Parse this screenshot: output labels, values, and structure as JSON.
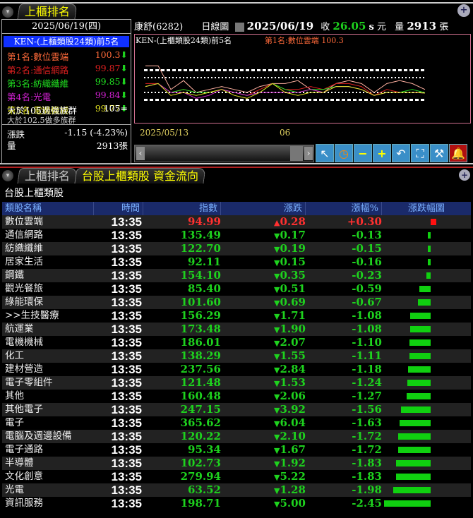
{
  "top_tab": "上櫃排名",
  "ranking_panel": {
    "date": "2025/06/19(四)",
    "title": "KEN-(上櫃類股24類)前5名",
    "items": [
      {
        "label": "第1名:數位雲端",
        "value": "100.3",
        "color": "#ff6a3a"
      },
      {
        "label": "第2名:通信網路",
        "value": "99.87",
        "color": "#e02020"
      },
      {
        "label": "第3名:紡織纖維",
        "value": "99.85",
        "color": "#20e020"
      },
      {
        "label": "第4名:光電",
        "value": "99.84",
        "color": "#d020d0"
      },
      {
        "label": "第5名:電機機械",
        "value": "99.77",
        "color": "#e0e020"
      }
    ],
    "strong_label": "大於105過強族群",
    "strong_value": "105=",
    "bull_label": "大於102.5做多族群",
    "change_label": "漲跌",
    "change_value": "-1.15 (-4.23%)",
    "volume_label": "量",
    "volume_value": "2913張"
  },
  "chart_header": {
    "stock": "康舒(6282)",
    "period": "日線圖",
    "date": "2025/06/19",
    "close_label": "收",
    "close": "26.05",
    "close_suffix": "s",
    "unit": "元",
    "vol_label": "量",
    "vol": "2913",
    "vol_unit": "張"
  },
  "chart_data": {
    "type": "line",
    "title": "KEN-(上櫃類股24類)前5名",
    "legend": "第1名:數位雲端 100.3",
    "x_ticks": [
      "2025/05/13",
      "06"
    ],
    "ylim": [
      90,
      115
    ],
    "reference_lines": [
      107.5,
      105,
      100,
      97.5
    ],
    "series": [
      {
        "name": "數位雲端",
        "color": "#ffb0a0",
        "values": [
          109,
          109,
          101,
          104,
          100,
          101,
          102,
          101,
          100,
          102,
          103,
          103,
          104,
          101,
          100,
          103,
          104,
          103,
          100,
          103,
          104,
          103,
          101
        ]
      },
      {
        "name": "通信網路",
        "color": "#e02020",
        "values": [
          103,
          103,
          100,
          101,
          100,
          100,
          101,
          100,
          99,
          101,
          103,
          101,
          101,
          102,
          101,
          103,
          103,
          102,
          99,
          101,
          100,
          100,
          99.9
        ]
      },
      {
        "name": "紡織纖維",
        "color": "#20e020",
        "values": [
          102,
          103,
          100,
          101,
          100,
          100,
          101,
          100,
          99,
          100,
          103,
          101,
          100,
          101,
          101,
          102,
          102,
          101,
          99,
          100,
          100,
          101,
          99.9
        ]
      },
      {
        "name": "光電",
        "color": "#d020d0",
        "values": [
          102,
          103,
          100,
          100,
          98,
          99,
          101,
          100,
          99,
          100,
          100,
          100,
          100,
          101,
          100,
          102,
          102,
          101,
          99,
          100,
          100,
          100,
          99.8
        ]
      },
      {
        "name": "電機機械",
        "color": "#e0e020",
        "values": [
          102,
          103,
          99,
          100,
          99,
          100,
          101,
          99,
          98,
          100,
          103,
          100,
          99,
          100,
          100,
          102,
          102,
          101,
          99,
          100,
          100,
          100,
          99.8
        ]
      }
    ]
  },
  "bottom_tabs": [
    "上櫃排名",
    "台股上櫃類股 資金流向"
  ],
  "table_title": "台股上櫃類股",
  "columns": [
    "類股名稱",
    "時間",
    "指數",
    "漲跌",
    "漲幅%",
    "漲跌幅圖"
  ],
  "rows": [
    {
      "name": "數位雲端",
      "time": "13:35",
      "index": "94.99",
      "chg": "0.28",
      "pct": "+0.30",
      "pv": 0.3
    },
    {
      "name": "通信網路",
      "time": "13:35",
      "index": "135.49",
      "chg": "0.17",
      "pct": "-0.13",
      "pv": -0.13
    },
    {
      "name": "紡織纖維",
      "time": "13:35",
      "index": "122.70",
      "chg": "0.19",
      "pct": "-0.15",
      "pv": -0.15
    },
    {
      "name": "居家生活",
      "time": "13:35",
      "index": "92.11",
      "chg": "0.15",
      "pct": "-0.16",
      "pv": -0.16
    },
    {
      "name": "鋼鐵",
      "time": "13:35",
      "index": "154.10",
      "chg": "0.35",
      "pct": "-0.23",
      "pv": -0.23
    },
    {
      "name": "觀光餐旅",
      "time": "13:35",
      "index": "85.40",
      "chg": "0.51",
      "pct": "-0.59",
      "pv": -0.59
    },
    {
      "name": "綠能環保",
      "time": "13:35",
      "index": "101.60",
      "chg": "0.69",
      "pct": "-0.67",
      "pv": -0.67
    },
    {
      "name": ">>生技醫療",
      "time": "13:35",
      "index": "156.29",
      "chg": "1.71",
      "pct": "-1.08",
      "pv": -1.08
    },
    {
      "name": "航運業",
      "time": "13:35",
      "index": "173.48",
      "chg": "1.90",
      "pct": "-1.08",
      "pv": -1.08
    },
    {
      "name": "電機機械",
      "time": "13:35",
      "index": "186.01",
      "chg": "2.07",
      "pct": "-1.10",
      "pv": -1.1
    },
    {
      "name": "化工",
      "time": "13:35",
      "index": "138.29",
      "chg": "1.55",
      "pct": "-1.11",
      "pv": -1.11
    },
    {
      "name": "建材營造",
      "time": "13:35",
      "index": "237.56",
      "chg": "2.84",
      "pct": "-1.18",
      "pv": -1.18
    },
    {
      "name": "電子零組件",
      "time": "13:35",
      "index": "121.48",
      "chg": "1.53",
      "pct": "-1.24",
      "pv": -1.24
    },
    {
      "name": "其他",
      "time": "13:35",
      "index": "160.48",
      "chg": "2.06",
      "pct": "-1.27",
      "pv": -1.27
    },
    {
      "name": "其他電子",
      "time": "13:35",
      "index": "247.15",
      "chg": "3.92",
      "pct": "-1.56",
      "pv": -1.56
    },
    {
      "name": "電子",
      "time": "13:35",
      "index": "365.62",
      "chg": "6.04",
      "pct": "-1.63",
      "pv": -1.63
    },
    {
      "name": "電腦及週邊設備",
      "time": "13:35",
      "index": "120.22",
      "chg": "2.10",
      "pct": "-1.72",
      "pv": -1.72
    },
    {
      "name": "電子通路",
      "time": "13:35",
      "index": "95.34",
      "chg": "1.67",
      "pct": "-1.72",
      "pv": -1.72
    },
    {
      "name": "半導體",
      "time": "13:35",
      "index": "102.73",
      "chg": "1.92",
      "pct": "-1.83",
      "pv": -1.83
    },
    {
      "name": "文化創意",
      "time": "13:35",
      "index": "279.94",
      "chg": "5.22",
      "pct": "-1.83",
      "pv": -1.83
    },
    {
      "name": "光電",
      "time": "13:35",
      "index": "63.52",
      "chg": "1.28",
      "pct": "-1.98",
      "pv": -1.98
    },
    {
      "name": "資訊服務",
      "time": "13:35",
      "index": "198.71",
      "chg": "5.00",
      "pct": "-2.45",
      "pv": -2.45
    }
  ]
}
